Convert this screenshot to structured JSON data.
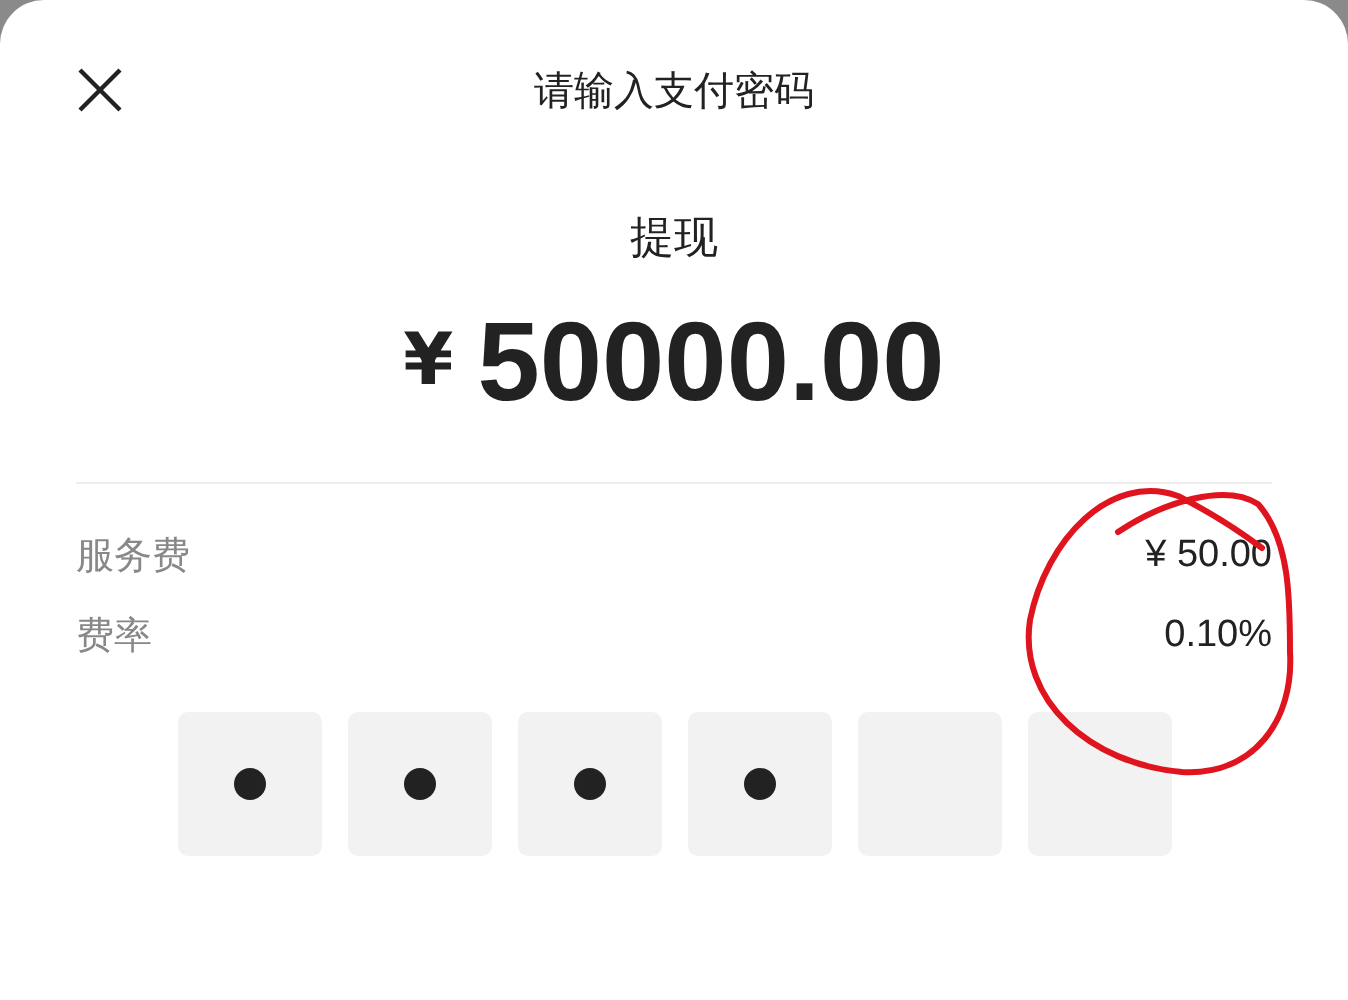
{
  "header": {
    "title": "请输入支付密码"
  },
  "payment": {
    "label": "提现",
    "currency": "¥",
    "amount": "50000.00"
  },
  "details": [
    {
      "label": "服务费",
      "value": "¥ 50.00"
    },
    {
      "label": "费率",
      "value": "0.10%"
    }
  ],
  "annotation": {
    "kind": "circle",
    "color": "#e0141e"
  },
  "pin": [
    {
      "filled": true
    },
    {
      "filled": true
    },
    {
      "filled": true
    },
    {
      "filled": true
    },
    {
      "filled": false
    },
    {
      "filled": false
    }
  ]
}
